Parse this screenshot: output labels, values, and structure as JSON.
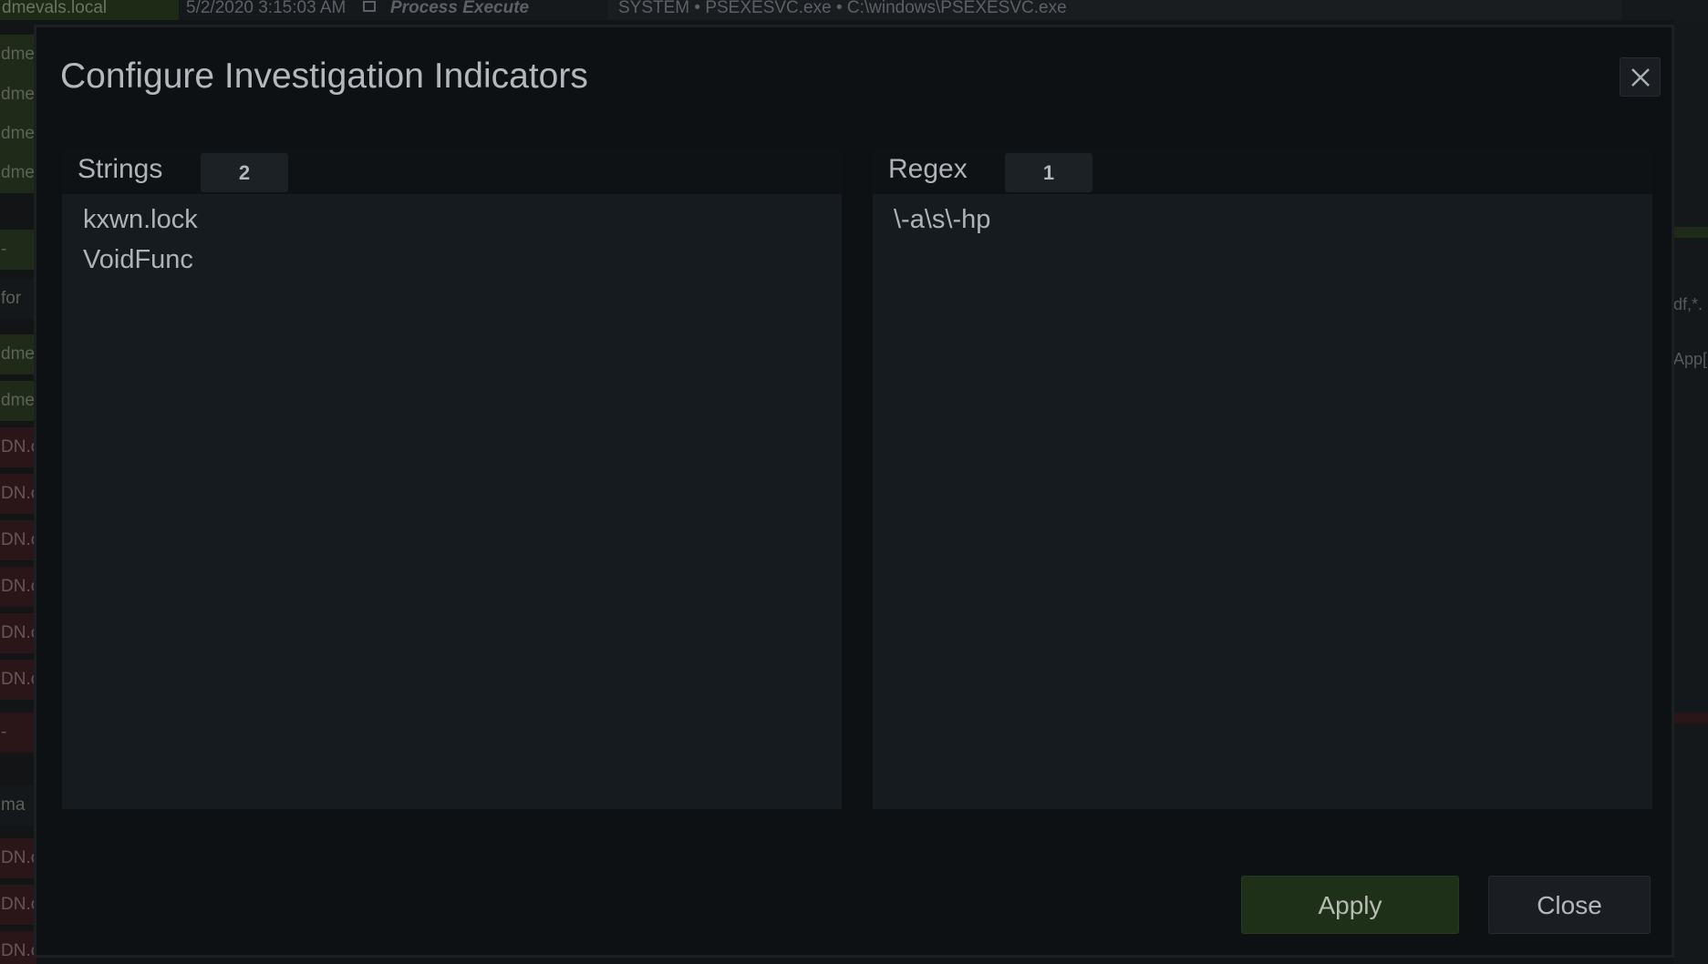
{
  "background": {
    "host": "dmevals.local",
    "timestamp": "5/2/2020 3:15:03 AM",
    "event_type": "Process Execute",
    "detail": "SYSTEM  •  PSEXESVC.exe  •  C:\\windows\\PSEXESVC.exe",
    "left_rows": [
      "dme",
      "dme",
      "dme",
      "dme",
      "-",
      "for",
      "dme",
      "dme",
      "DN.c",
      "DN.c",
      "DN.c",
      "DN.c",
      "DN.c",
      "DN.c",
      "-",
      "ma",
      "DN.c",
      "DN.c",
      "DN.c"
    ],
    "right_fragments": [
      "df,*.",
      "App["
    ]
  },
  "modal": {
    "title": "Configure Investigation Indicators",
    "close_icon": "close-icon",
    "strings": {
      "label": "Strings",
      "count": "2",
      "items": [
        "kxwn.lock",
        "VoidFunc"
      ]
    },
    "regex": {
      "label": "Regex",
      "count": "1",
      "items": [
        "\\-a\\s\\-hp"
      ]
    },
    "apply_label": "Apply",
    "close_label": "Close"
  },
  "colors": {
    "modal_bg": "#0e1113",
    "panel_bg": "#161b1f",
    "apply_bg": "#1f3018",
    "text": "#b3b8bd"
  }
}
